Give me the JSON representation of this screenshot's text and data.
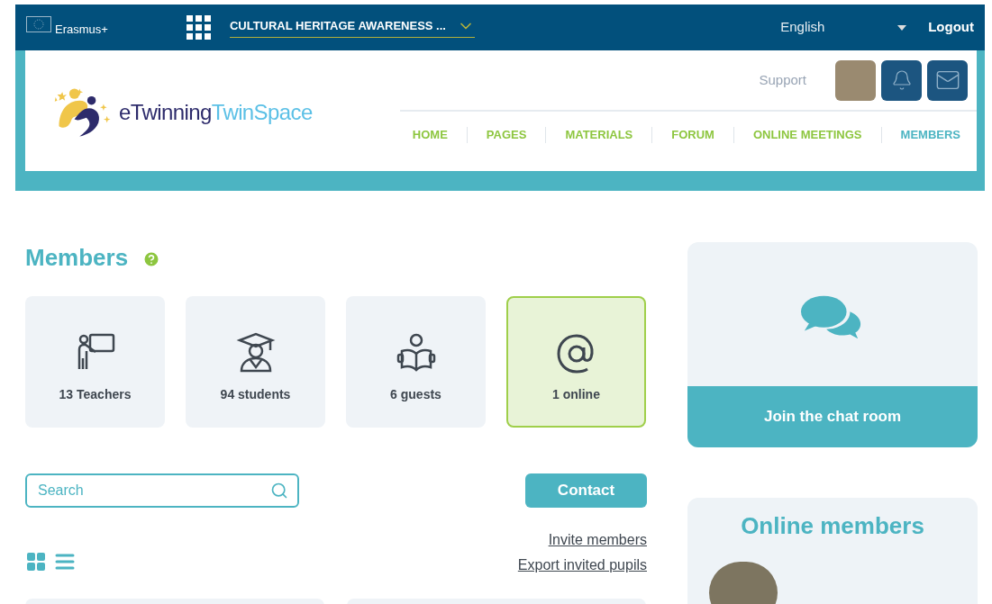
{
  "top_bar": {
    "program": "Erasmus+",
    "project": "CULTURAL HERITAGE AWARENESS ...",
    "language": "English",
    "logout": "Logout"
  },
  "header": {
    "logo_left": "eTwinning",
    "logo_right": "TwinSpace",
    "support": "Support",
    "nav": [
      {
        "label": "HOME",
        "selected": false
      },
      {
        "label": "PAGES",
        "selected": false
      },
      {
        "label": "MATERIALS",
        "selected": false
      },
      {
        "label": "FORUM",
        "selected": false
      },
      {
        "label": "ONLINE MEETINGS",
        "selected": false
      },
      {
        "label": "MEMBERS",
        "selected": true
      }
    ]
  },
  "members": {
    "title": "Members",
    "stats": [
      {
        "kind": "teachers",
        "label": "13 Teachers",
        "selected": false
      },
      {
        "kind": "students",
        "label": "94 students",
        "selected": false
      },
      {
        "kind": "guests",
        "label": "6 guests",
        "selected": false
      },
      {
        "kind": "online",
        "label": "1 online",
        "selected": true
      }
    ],
    "search": {
      "placeholder": "Search"
    },
    "contact": "Contact",
    "links": [
      "Invite members",
      "Export invited pupils"
    ]
  },
  "chat": {
    "button": "Join the chat room"
  },
  "online_members": {
    "title": "Online members"
  }
}
